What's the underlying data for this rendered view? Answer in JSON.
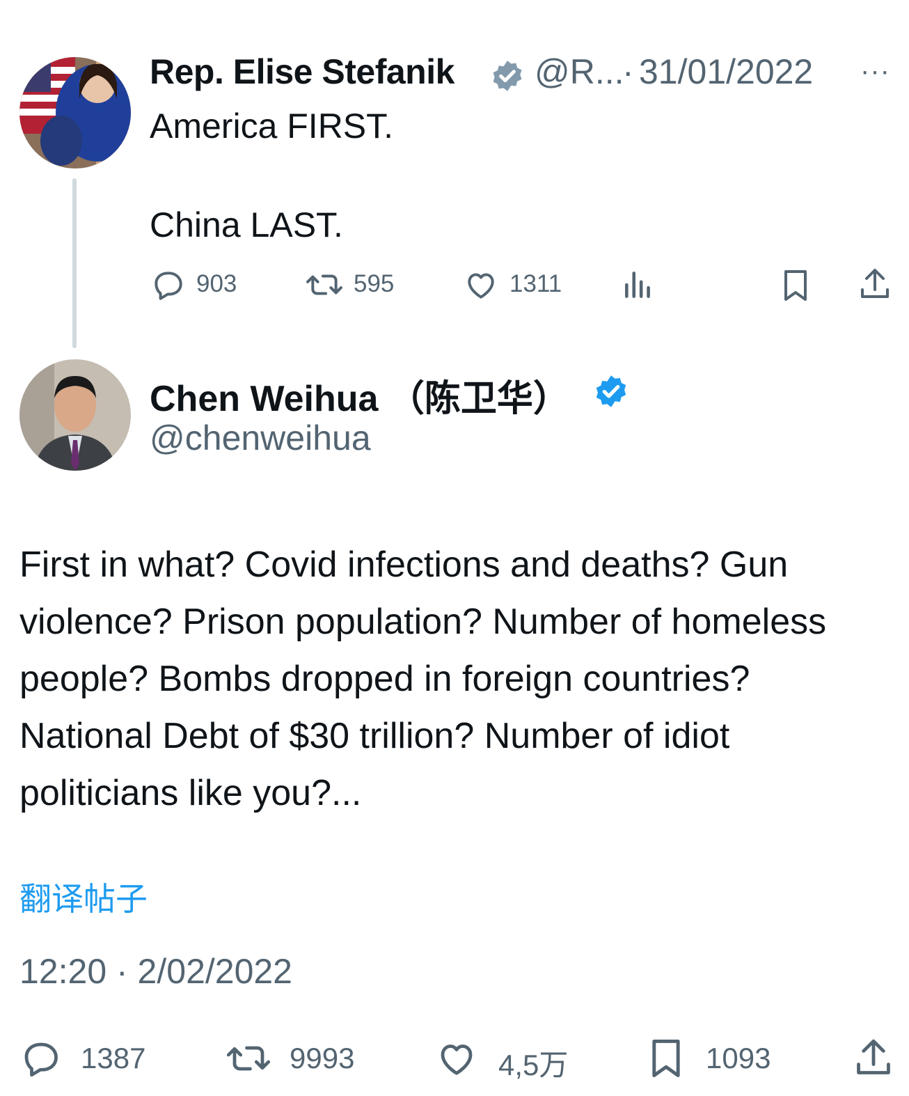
{
  "first_tweet": {
    "author_name": "Rep. Elise Stefanik",
    "handle": "@R...",
    "separator": "·",
    "date": "31/01/2022",
    "text_line1": "America FIRST.",
    "text_line2": "China LAST.",
    "replies": "903",
    "retweets": "595",
    "likes": "1311",
    "more_label": "···"
  },
  "second_tweet": {
    "author_name": "Chen Weihua （陈卫华）",
    "handle": "@chenweihua",
    "text": "First in what? Covid infections and deaths? Gun violence? Prison population? Number of homeless people? Bombs dropped in foreign countries? National Debt of $30 trillion? Number of idiot politicians like you?...",
    "translate_link": "翻译帖子",
    "timestamp": "12:20 · 2/02/2022",
    "replies": "1387",
    "retweets": "9993",
    "likes": "4,5万",
    "bookmarks": "1093"
  },
  "colors": {
    "text": "#0f1419",
    "secondary": "#536471",
    "accent": "#1d9bf0",
    "thread_line": "#cfd9de",
    "gov_badge": "#829aab"
  },
  "icons": [
    "reply-icon",
    "retweet-icon",
    "like-icon",
    "views-icon",
    "bookmark-icon",
    "share-icon",
    "verified-badge-icon",
    "government-badge-icon",
    "more-icon"
  ]
}
